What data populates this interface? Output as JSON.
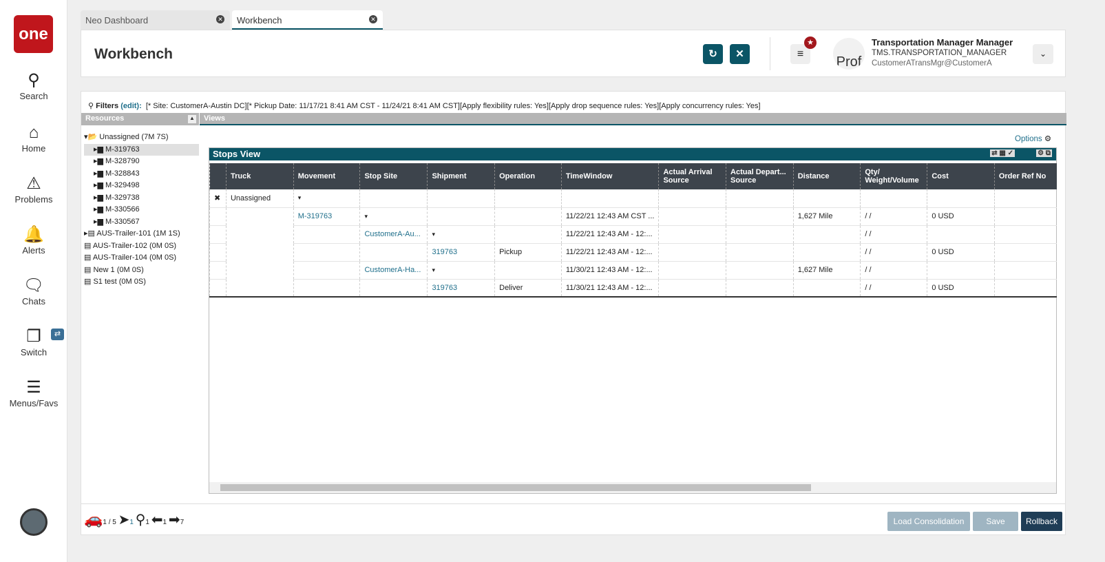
{
  "sidebar": {
    "logo": "one",
    "items": [
      {
        "label": "Search",
        "icon": "search-icon"
      },
      {
        "label": "Home",
        "icon": "home-icon"
      },
      {
        "label": "Problems",
        "icon": "warning-icon"
      },
      {
        "label": "Alerts",
        "icon": "bell-icon"
      },
      {
        "label": "Chats",
        "icon": "chat-icon"
      },
      {
        "label": "Switch",
        "icon": "switch-icon"
      },
      {
        "label": "Menus/Favs",
        "icon": "menu-icon"
      }
    ]
  },
  "tabs": [
    {
      "label": "Neo Dashboard"
    },
    {
      "label": "Workbench"
    }
  ],
  "header": {
    "title": "Workbench",
    "user_name": "Transportation Manager Manager",
    "user_role": "TMS.TRANSPORTATION_MANAGER",
    "user_email": "CustomerATransMgr@CustomerA",
    "avatar_text": "Prof"
  },
  "filters": {
    "label": "Filters",
    "edit": "(edit):",
    "text": "[* Site: CustomerA-Austin DC][* Pickup Date: 11/17/21 8:41 AM CST - 11/24/21 8:41 AM CST][Apply flexibility rules: Yes][Apply drop sequence rules: Yes][Apply concurrency rules: Yes]"
  },
  "resources": {
    "title": "Resources",
    "tree": [
      {
        "label": "Unassigned (7M 7S)",
        "level": 0,
        "type": "folder-open"
      },
      {
        "label": "M-319763",
        "level": 1,
        "type": "folder",
        "selected": true
      },
      {
        "label": "M-328790",
        "level": 1,
        "type": "folder"
      },
      {
        "label": "M-328843",
        "level": 1,
        "type": "folder"
      },
      {
        "label": "M-329498",
        "level": 1,
        "type": "folder"
      },
      {
        "label": "M-329738",
        "level": 1,
        "type": "folder"
      },
      {
        "label": "M-330566",
        "level": 1,
        "type": "folder"
      },
      {
        "label": "M-330567",
        "level": 1,
        "type": "folder"
      },
      {
        "label": "AUS-Trailer-101 (1M 1S)",
        "level": 0,
        "type": "doc-arrow"
      },
      {
        "label": "AUS-Trailer-102 (0M 0S)",
        "level": 0,
        "type": "doc"
      },
      {
        "label": "AUS-Trailer-104 (0M 0S)",
        "level": 0,
        "type": "doc"
      },
      {
        "label": "New 1 (0M 0S)",
        "level": 0,
        "type": "doc"
      },
      {
        "label": "S1 test (0M 0S)",
        "level": 0,
        "type": "doc"
      }
    ]
  },
  "views": {
    "title": "Views",
    "options": "Options",
    "stops_view": "Stops View",
    "columns": [
      "",
      "Truck",
      "Movement",
      "Stop Site",
      "Shipment",
      "Operation",
      "TimeWindow",
      "Actual Arrival Source",
      "Actual Depart... Source",
      "Distance",
      "Qty/ Weight/Volume",
      "Cost",
      "Order Ref No"
    ],
    "rows": [
      [
        "✖",
        "Unassigned",
        "▾",
        "",
        "",
        "",
        "",
        "",
        "",
        "",
        "",
        "",
        ""
      ],
      [
        "",
        "",
        "M-319763",
        "▾",
        "",
        "",
        "11/22/21 12:43 AM CST ...",
        "",
        "",
        "1,627 Mile",
        "/ /",
        "0 USD",
        ""
      ],
      [
        "",
        "",
        "",
        "CustomerA-Au...",
        "▾",
        "",
        "11/22/21 12:43 AM - 12:...",
        "",
        "",
        "",
        "/ /",
        "",
        ""
      ],
      [
        "",
        "",
        "",
        "",
        "319763",
        "Pickup",
        "11/22/21 12:43 AM - 12:...",
        "",
        "",
        "",
        "/ /",
        "0 USD",
        ""
      ],
      [
        "",
        "",
        "",
        "CustomerA-Ha...",
        "▾",
        "",
        "11/30/21 12:43 AM - 12:...",
        "",
        "",
        "1,627 Mile",
        "/ /",
        "",
        ""
      ],
      [
        "",
        "",
        "",
        "",
        "319763",
        "Deliver",
        "11/30/21 12:43 AM - 12:...",
        "",
        "",
        "",
        "/ /",
        "0 USD",
        ""
      ]
    ]
  },
  "footer": {
    "counts": [
      "1 / 5",
      "1",
      "1",
      "1",
      "7"
    ],
    "load_consolidation": "Load Consolidation",
    "save": "Save",
    "rollback": "Rollback"
  }
}
